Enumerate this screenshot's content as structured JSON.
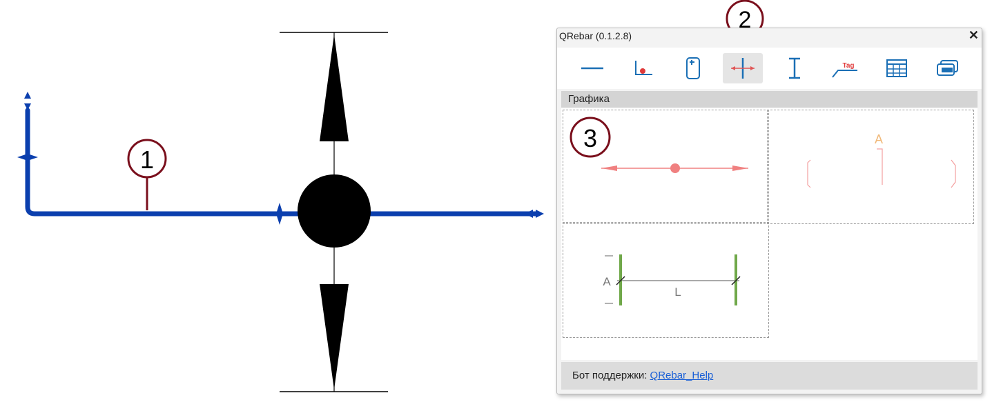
{
  "callouts": [
    "1",
    "2",
    "3"
  ],
  "window": {
    "title": "QRebar (0.1.2.8)",
    "close_glyph": "✕"
  },
  "toolbar": {
    "buttons": [
      {
        "name": "line-tool"
      },
      {
        "name": "point-tool"
      },
      {
        "name": "panel-tool"
      },
      {
        "name": "dimension-tool",
        "active": true
      },
      {
        "name": "i-beam-tool"
      },
      {
        "name": "tag-tool",
        "label": "Tag"
      },
      {
        "name": "table-tool"
      },
      {
        "name": "copy-tool"
      }
    ]
  },
  "section": {
    "label": "Графика"
  },
  "gallery": {
    "cell2_label": "A",
    "cell3_labels": {
      "a": "A",
      "l": "L"
    }
  },
  "footer": {
    "text": "Бот поддержки: ",
    "link": "QRebar_Help"
  },
  "colors": {
    "rebar_blue": "#0b3fae",
    "callout_red": "#7a0f1c",
    "accent_red": "#e05555",
    "bar_green": "#70a84a"
  }
}
